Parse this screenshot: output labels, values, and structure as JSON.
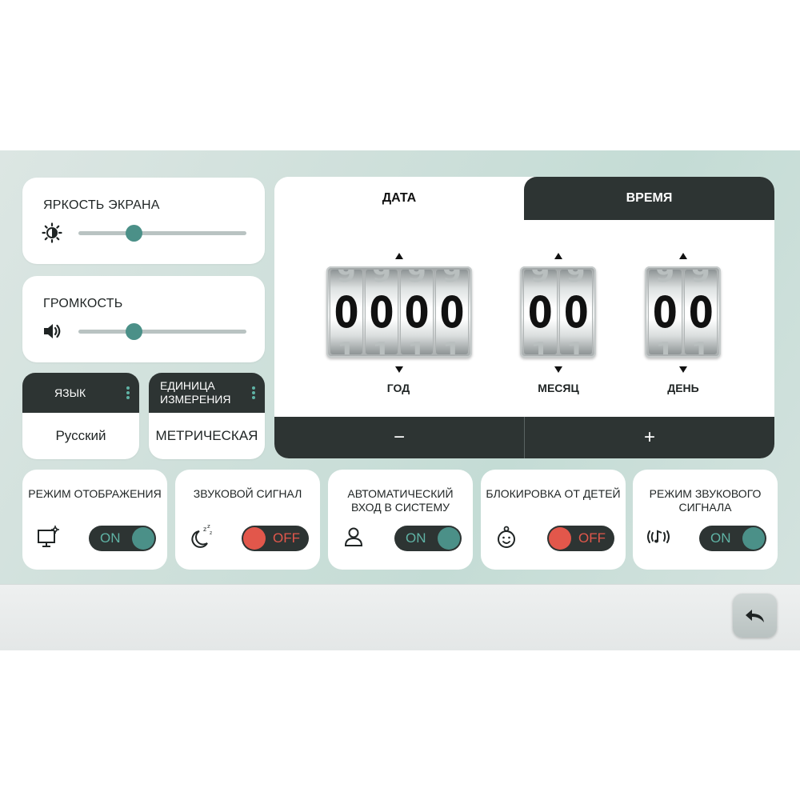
{
  "brightness": {
    "label": "ЯРКОСТЬ ЭКРАНА",
    "icon": "brightness-icon",
    "value_pct": 33
  },
  "volume": {
    "label": "ГРОМКОСТЬ",
    "icon": "speaker-icon",
    "value_pct": 33
  },
  "language": {
    "label": "ЯЗЫК",
    "value": "Русский",
    "icon": "kebab-menu-icon"
  },
  "units": {
    "label_line1": "ЕДИНИЦА",
    "label_line2": "ИЗМЕРЕНИЯ",
    "value": "МЕТРИЧЕСКАЯ",
    "icon": "kebab-menu-icon"
  },
  "datetime": {
    "tabs": {
      "date": "ДАТА",
      "time": "ВРЕМЯ"
    },
    "active_tab": "date",
    "year": {
      "label": "ГОД",
      "digits": [
        "0",
        "0",
        "0",
        "0"
      ],
      "above": "9",
      "below": "1"
    },
    "month": {
      "label": "МЕСЯЦ",
      "digits": [
        "0",
        "0"
      ],
      "above": "9",
      "below": "1"
    },
    "day": {
      "label": "ДЕНЬ",
      "digits": [
        "0",
        "0"
      ],
      "above": "9",
      "below": "1"
    },
    "minus_label": "−",
    "plus_label": "+"
  },
  "toggles": [
    {
      "title": "РЕЖИМ ОТОБРАЖЕНИЯ",
      "icon": "monitor-settings-icon",
      "state": "ON"
    },
    {
      "title": "ЗВУКОВОЙ СИГНАЛ",
      "icon": "moon-sleep-icon",
      "state": "OFF"
    },
    {
      "title": "АВТОМАТИЧЕСКИЙ ВХОД В СИСТЕМУ",
      "icon": "user-icon",
      "state": "ON"
    },
    {
      "title": "БЛОКИРОВКА ОТ ДЕТЕЙ",
      "icon": "baby-icon",
      "state": "OFF"
    },
    {
      "title": "РЕЖИМ ЗВУКОВОГО СИГНАЛА",
      "icon": "music-note-waves-icon",
      "state": "ON"
    }
  ],
  "back_button": {
    "icon": "undo-arrow-icon"
  },
  "colors": {
    "accent": "#4b9088",
    "off": "#e2574b",
    "dark": "#2d3433"
  }
}
